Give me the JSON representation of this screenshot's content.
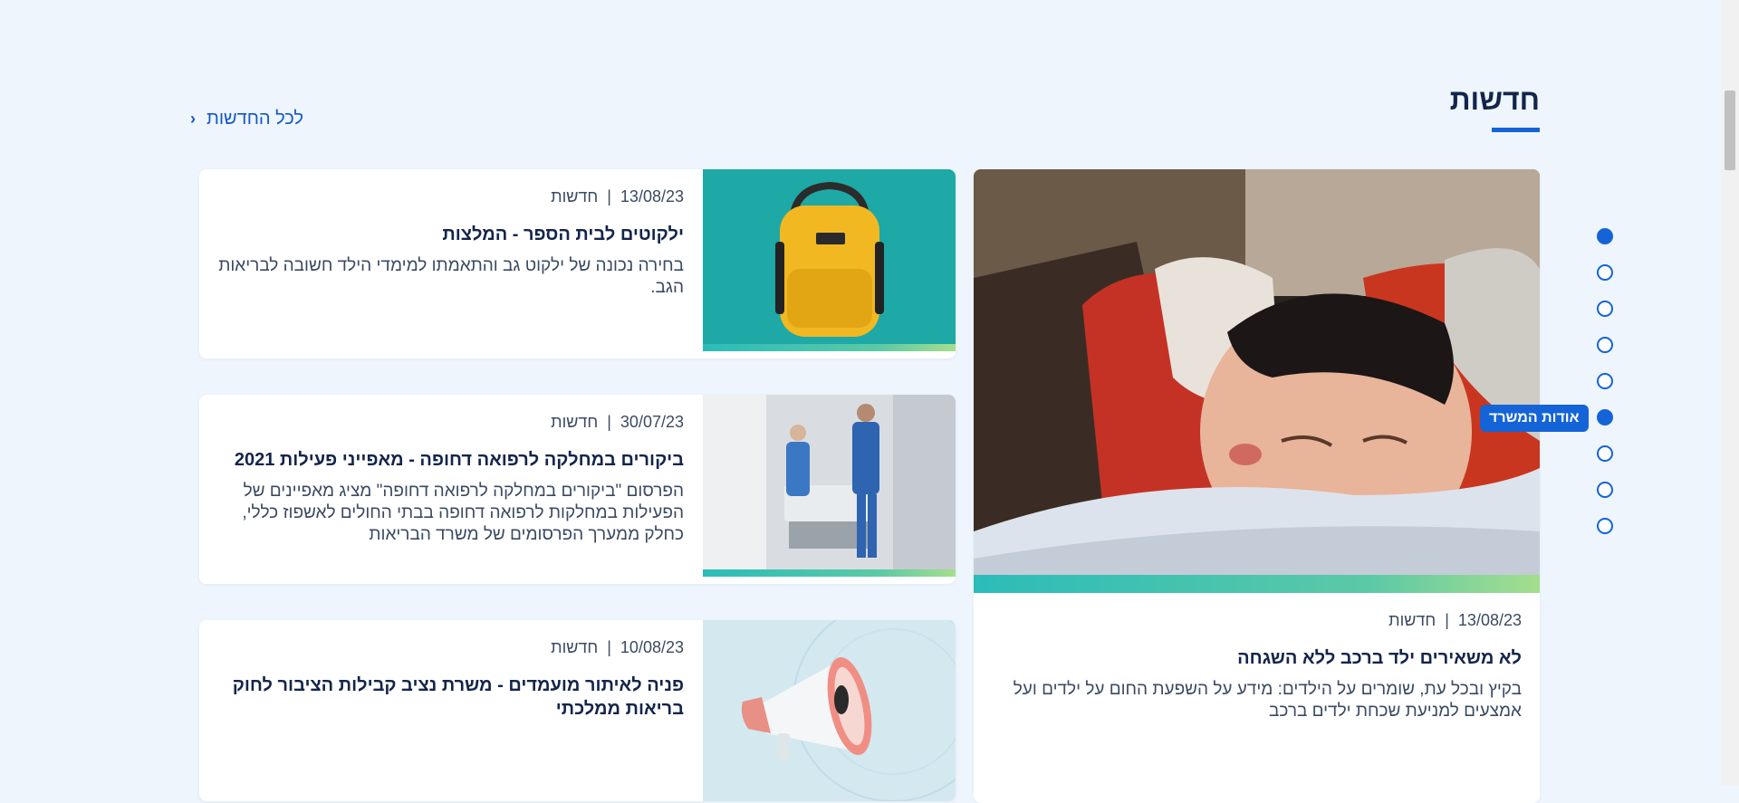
{
  "section": {
    "title": "חדשות"
  },
  "all_news": {
    "label": "לכל החדשות"
  },
  "featured": {
    "date": "13/08/23",
    "category": "חדשות",
    "title": "לא משאירים ילד ברכב ללא השגחה",
    "description": "בקיץ ובכל עת, שומרים על הילדים: מידע על השפעת החום על ילדים ועל אמצעים למניעת שכחת ילדים ברכב"
  },
  "cards": [
    {
      "date": "13/08/23",
      "category": "חדשות",
      "title": "ילקוטים לבית הספר - המלצות",
      "description": "בחירה נכונה של ילקוט גב והתאמתו למימדי הילד חשובה לבריאות הגב."
    },
    {
      "date": "30/07/23",
      "category": "חדשות",
      "title": "ביקורים במחלקה לרפואה דחופה - מאפייני פעילות 2021",
      "description": "הפרסום \"ביקורים במחלקה לרפואה דחופה\" מציג מאפיינים של הפעילות במחלקות לרפואה דחופה בבתי החולים לאשפוז כללי, כחלק ממערך הפרסומים של משרד הבריאות"
    },
    {
      "date": "10/08/23",
      "category": "חדשות",
      "title": "פניה לאיתור מועמדים - משרת נציב קבילות הציבור לחוק בריאות ממלכתי",
      "description": ""
    }
  ],
  "section_nav": {
    "tooltip": "אודות המשרד",
    "dots": [
      {
        "state": "filled"
      },
      {
        "state": "outline"
      },
      {
        "state": "outline"
      },
      {
        "state": "outline"
      },
      {
        "state": "outline"
      },
      {
        "state": "filled"
      },
      {
        "state": "outline"
      },
      {
        "state": "outline"
      },
      {
        "state": "outline"
      }
    ]
  },
  "colors": {
    "accent": "#1464d8",
    "background": "#eef5fd",
    "title": "#14254a"
  }
}
